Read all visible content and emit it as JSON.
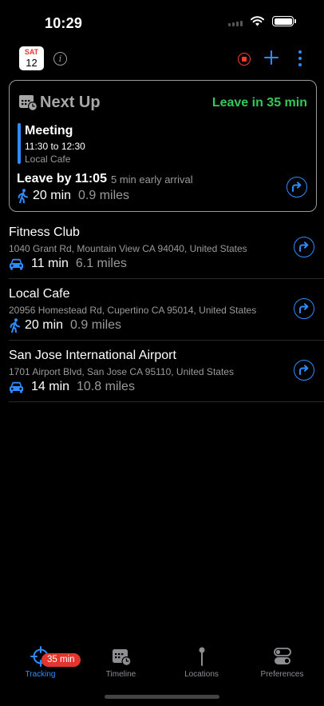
{
  "status_bar": {
    "time": "10:29"
  },
  "nav": {
    "calendar_day": "SAT",
    "calendar_date": "12"
  },
  "next_up": {
    "title": "Next Up",
    "leave_in": "Leave in 35 min",
    "event": {
      "title": "Meeting",
      "time": "11:30 to 12:30",
      "location": "Local Cafe"
    },
    "leave_by": "Leave by 11:05",
    "early_note": "5 min early arrival",
    "duration": "20 min",
    "distance": "0.9 miles"
  },
  "locations": [
    {
      "name": "Fitness Club",
      "address": "1040 Grant Rd, Mountain View CA 94040, United States",
      "mode": "car-icon",
      "duration": "11 min",
      "distance": "6.1 miles"
    },
    {
      "name": "Local Cafe",
      "address": "20956 Homestead Rd, Cupertino CA 95014, United States",
      "mode": "walk-icon",
      "duration": "20 min",
      "distance": "0.9 miles"
    },
    {
      "name": "San Jose International Airport",
      "address": "1701 Airport Blvd, San Jose CA 95110, United States",
      "mode": "car-icon",
      "duration": "14 min",
      "distance": "10.8 miles"
    }
  ],
  "tabs": [
    {
      "label": "Tracking",
      "icon": "crosshair-icon",
      "badge": "35 min",
      "active": true
    },
    {
      "label": "Timeline",
      "icon": "calendar-clock-icon"
    },
    {
      "label": "Locations",
      "icon": "pin-icon"
    },
    {
      "label": "Preferences",
      "icon": "toggles-icon"
    }
  ],
  "colors": {
    "accent": "#2f8cff",
    "leave_green": "#34c759",
    "record_red": "#ff3b30",
    "badge_red": "#e3352f"
  }
}
